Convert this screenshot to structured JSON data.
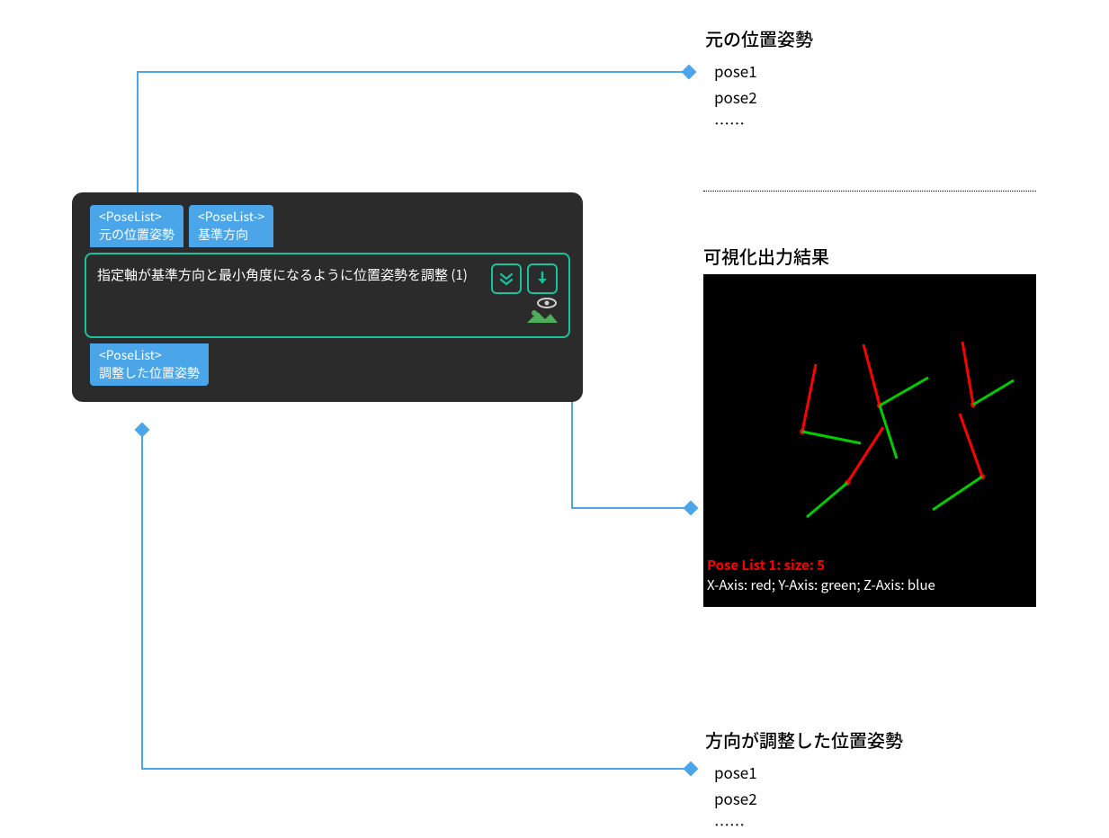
{
  "node": {
    "inputs": [
      {
        "type": "<PoseList>",
        "name": "元の位置姿勢"
      },
      {
        "type": "<PoseList->",
        "name": "基準方向"
      }
    ],
    "title": "指定軸が基準方向と最小角度になるように位置姿勢を調整 (1)",
    "outputs": [
      {
        "type": "<PoseList>",
        "name": "調整した位置姿勢"
      }
    ]
  },
  "callout_input": {
    "title": "元の位置姿勢",
    "items": [
      "pose1",
      "pose2",
      "……"
    ]
  },
  "callout_output": {
    "title": "方向が調整した位置姿勢",
    "items": [
      "pose1",
      "pose2",
      "……"
    ]
  },
  "visualization": {
    "title": "可視化出力結果",
    "label_red": "Pose List 1: size: 5",
    "label_white": "X-Axis: red; Y-Axis: green; Z-Axis: blue"
  }
}
